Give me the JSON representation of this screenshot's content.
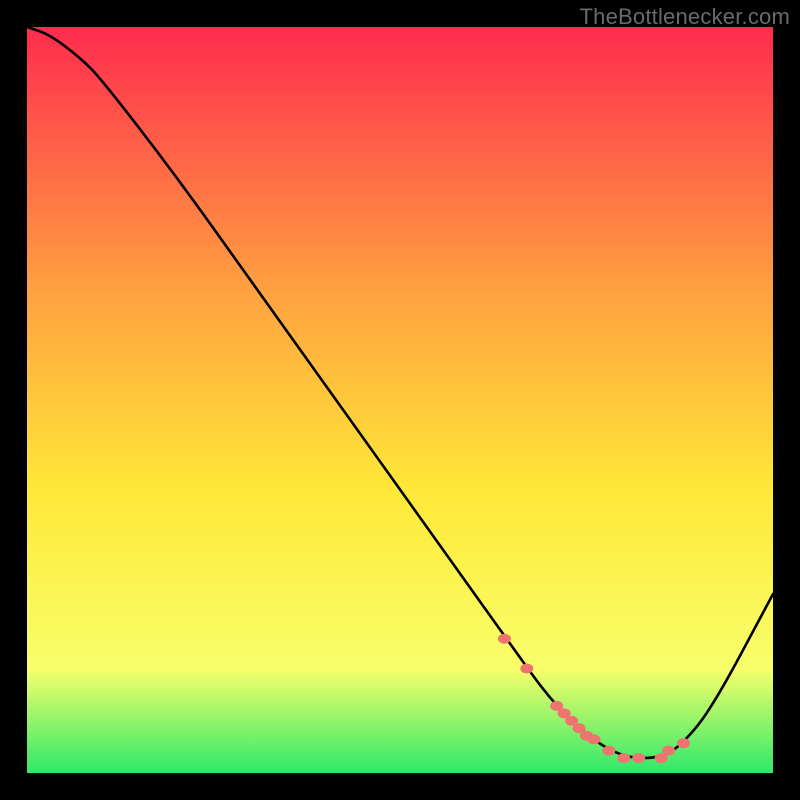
{
  "watermark": "TheBottlenecker.com",
  "colors": {
    "gradient_top": "#ff2b4e",
    "gradient_upper_mid": "#ffa040",
    "gradient_mid": "#ffe838",
    "gradient_lower": "#f8ff6a",
    "gradient_bottom": "#2fe86a",
    "curve": "#000000",
    "marker": "#ef7470",
    "background": "#000000"
  },
  "chart_data": {
    "type": "line",
    "title": "",
    "xlabel": "",
    "ylabel": "",
    "xlim": [
      0,
      100
    ],
    "ylim": [
      0,
      100
    ],
    "grid": false,
    "legend": false,
    "series": [
      {
        "name": "curve",
        "x": [
          0,
          3,
          7,
          10,
          20,
          30,
          40,
          50,
          60,
          65,
          70,
          75,
          80,
          85,
          88,
          92,
          100
        ],
        "y": [
          100,
          99,
          96,
          93,
          80,
          66,
          52,
          38,
          24,
          17,
          10,
          5,
          2,
          2,
          4,
          9,
          24
        ]
      }
    ],
    "markers": {
      "name": "highlight-zone",
      "x": [
        64,
        67,
        71,
        72,
        73,
        74,
        75,
        76,
        78,
        80,
        82,
        85,
        86,
        88
      ],
      "y": [
        18,
        14,
        9,
        8,
        7,
        6,
        5,
        4.5,
        3,
        2,
        2,
        2,
        3,
        4
      ]
    }
  }
}
